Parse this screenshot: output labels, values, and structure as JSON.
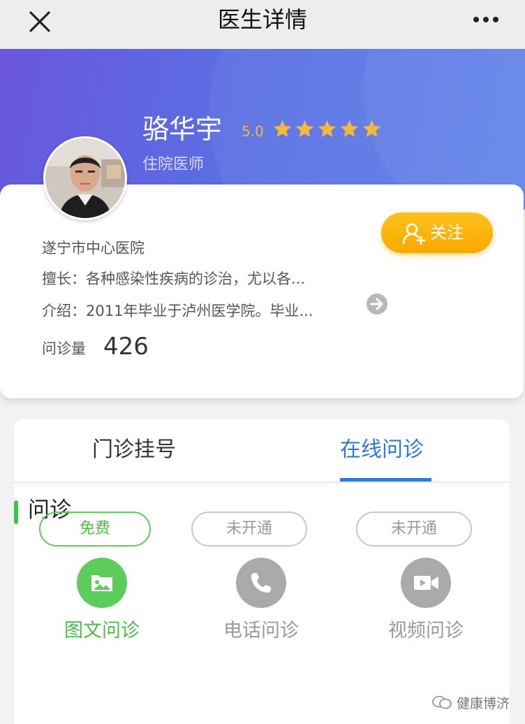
{
  "nav": {
    "title": "医生详情",
    "close_icon": "close-icon",
    "more_icon": "more-dots-icon"
  },
  "doctor": {
    "name": "骆华宇",
    "rating": "5.0",
    "stars": 5,
    "title": "住院医师",
    "hospital": "遂宁市中心医院",
    "specialty": "擅长：各种感染性疾病的诊治，尤以各...",
    "intro": "介绍：2011年毕业于泸州医学院。毕业...",
    "consult_label": "问诊量",
    "consult_count": "426"
  },
  "follow_button": {
    "label": "关注",
    "icon": "follow-user-icon"
  },
  "tabs": [
    {
      "label": "门诊挂号",
      "active": false
    },
    {
      "label": "在线问诊",
      "active": true
    }
  ],
  "section": {
    "title": "问诊"
  },
  "services": [
    {
      "label": "图文问诊",
      "badge": "免费",
      "icon": "image-folder-icon",
      "enabled": true
    },
    {
      "label": "电话问诊",
      "badge": "未开通",
      "icon": "phone-icon",
      "enabled": false
    },
    {
      "label": "视频问诊",
      "badge": "未开通",
      "icon": "video-camera-icon",
      "enabled": false
    }
  ],
  "watermark": {
    "text": "健康博济"
  },
  "colors": {
    "accent_blue": "#2f7ad6",
    "green": "#5ccc5a",
    "follow_orange": "#f8a800",
    "star": "#f5b83a",
    "hero_purple": "#6a56dd",
    "disabled_gray": "#aaaaaa"
  }
}
